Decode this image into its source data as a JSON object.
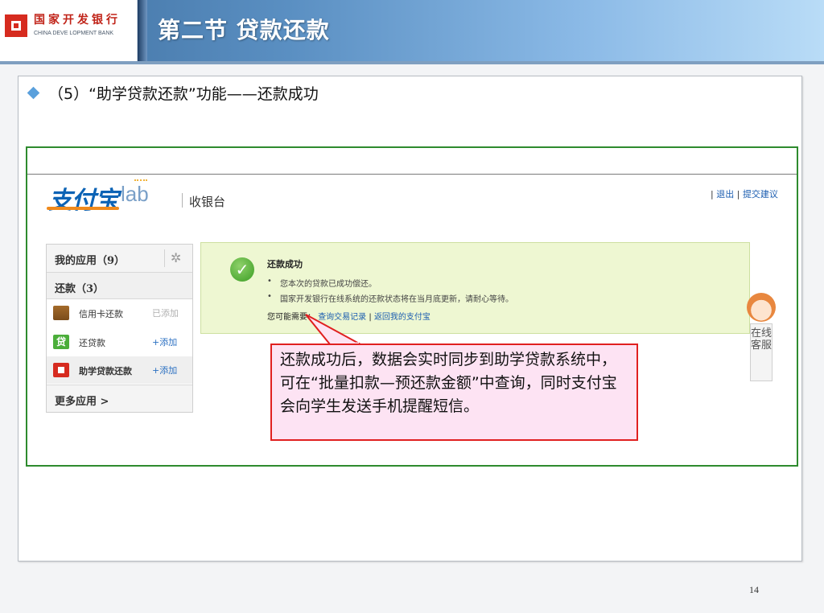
{
  "header": {
    "bank_name_cn": "国家开发银行",
    "bank_name_en": "CHINA DEVE LOPMENT BANK",
    "title": "第二节  贷款还款"
  },
  "slide": {
    "subtitle": "（5）“助学贷款还款”功能——还款成功",
    "page_number": "14"
  },
  "screenshot": {
    "brand_logo": "支付宝",
    "lab_logo": "lab",
    "cashier_label": "收银台",
    "top_links": {
      "prefix": "|",
      "logout": "退出",
      "sep": "|",
      "feedback": "提交建议"
    },
    "app_menu": {
      "my_apps": "我的应用（9）",
      "section": "还款（3）",
      "items": [
        {
          "name": "信用卡还款",
          "action": "已添加",
          "icon": "credit-card-icon"
        },
        {
          "name": "还贷款",
          "action": "+添加",
          "icon": "loan-icon",
          "icon_text": "贷"
        },
        {
          "name": "助学贷款还款",
          "action": "+添加",
          "icon": "cdb-logo-icon"
        }
      ],
      "more": "更多应用 >"
    },
    "success": {
      "title": "还款成功",
      "lines": [
        "您本次的贷款已成功偿还。",
        "国家开发银行在线系统的还款状态将在当月底更新，请耐心等待。"
      ],
      "need_prefix": "您可能需要：",
      "link_records": "查询交易记录",
      "link_sep": "|",
      "link_home": "返回我的支付宝"
    },
    "online_service": "在线客服"
  },
  "callout": {
    "text": "还款成功后，数据会实时同步到助学贷款系统中，可在“批量扣款—预还款金额”中查询，同时支付宝会向学生发送手机提醒短信。"
  },
  "colors": {
    "frame_border": "#2e8b2e",
    "callout_border": "#e02020",
    "callout_fill": "#fde3f3",
    "success_fill": "#eef7d2",
    "link": "#1b5db0"
  }
}
